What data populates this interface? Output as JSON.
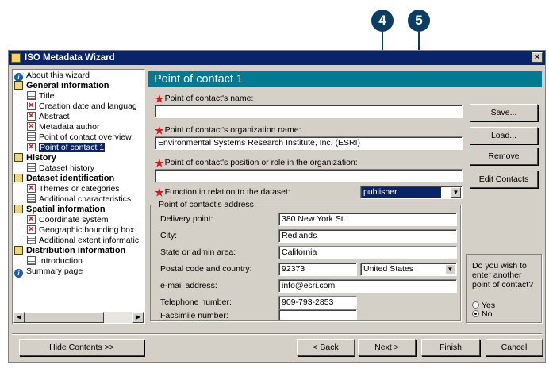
{
  "callouts": [
    "4",
    "5"
  ],
  "window": {
    "title": "ISO Metadata Wizard",
    "close_glyph": "×"
  },
  "tree": {
    "items": [
      {
        "label": "About this wizard"
      },
      {
        "label": "General information"
      },
      {
        "label": "Title"
      },
      {
        "label": "Creation date and languag"
      },
      {
        "label": "Abstract"
      },
      {
        "label": "Metadata author"
      },
      {
        "label": "Point of contact overview"
      },
      {
        "label": "Point of contact 1"
      },
      {
        "label": "History"
      },
      {
        "label": "Dataset history"
      },
      {
        "label": "Dataset identification"
      },
      {
        "label": "Themes or categories"
      },
      {
        "label": "Additional characteristics"
      },
      {
        "label": "Spatial information"
      },
      {
        "label": "Coordinate system"
      },
      {
        "label": "Geographic bounding box"
      },
      {
        "label": "Additional extent informatic"
      },
      {
        "label": "Distribution information"
      },
      {
        "label": "Introduction"
      },
      {
        "label": "Summary page"
      }
    ],
    "scroll_left": "◀",
    "scroll_right": "▶"
  },
  "header": {
    "title": "Point of contact 1"
  },
  "form": {
    "required_mark": "★",
    "name_label": "Point of contact's name:",
    "name_value": "",
    "org_label": "Point of contact's organization name:",
    "org_value": "Environmental Systems Research Institute, Inc. (ESRI)",
    "position_label": "Point of contact's position or role in the organization:",
    "position_value": "",
    "function_label": "Function in relation to the dataset:",
    "function_value": "publisher",
    "dropdown_glyph": "▼"
  },
  "address": {
    "group_title": "Point of contact's address",
    "delivery_label": "Delivery point:",
    "delivery_value": "380 New York St.",
    "city_label": "City:",
    "city_value": "Redlands",
    "state_label": "State or admin area:",
    "state_value": "California",
    "postal_label": "Postal code and country:",
    "postal_value": "92373",
    "country_value": "United States",
    "email_label": "e-mail address:",
    "email_value": "info@esri.com",
    "phone_label": "Telephone number:",
    "phone_value": "909-793-2853",
    "fax_label": "Facsimile number:",
    "fax_value": ""
  },
  "side_buttons": {
    "save": "Save...",
    "load": "Load...",
    "remove": "Remove",
    "edit_contacts": "Edit Contacts"
  },
  "another_contact": {
    "question": "Do you wish to enter another point of contact?",
    "yes": "Yes",
    "no": "No",
    "selected": "No"
  },
  "footer": {
    "hide_contents": "Hide Contents >>",
    "back": "< Back",
    "next": "Next >",
    "finish": "Finish",
    "cancel": "Cancel"
  }
}
